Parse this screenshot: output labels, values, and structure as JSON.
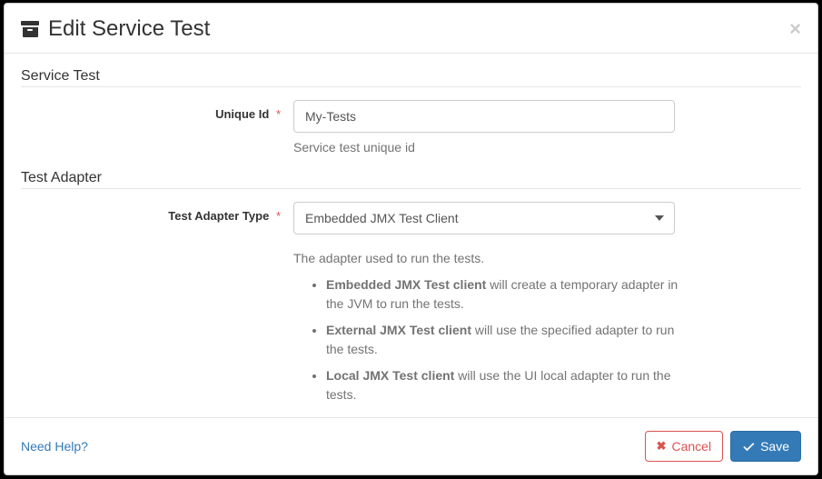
{
  "modal": {
    "title": "Edit Service Test",
    "close_label": "×"
  },
  "sections": {
    "service_test": {
      "legend": "Service Test",
      "unique_id": {
        "label": "Unique Id",
        "value": "My-Tests",
        "help": "Service test unique id"
      }
    },
    "test_adapter": {
      "legend": "Test Adapter",
      "type": {
        "label": "Test Adapter Type",
        "selected": "Embedded JMX Test Client",
        "help_intro": "The adapter used to run the tests.",
        "bullets": [
          {
            "strong": "Embedded JMX Test client",
            "rest": " will create a temporary adapter in the JVM to run the tests."
          },
          {
            "strong": "External JMX Test client",
            "rest": " will use the specified adapter to run the tests."
          },
          {
            "strong": "Local JMX Test client",
            "rest": " will use the UI local adapter to run the tests."
          }
        ]
      }
    }
  },
  "footer": {
    "help_link": "Need Help?",
    "cancel": "Cancel",
    "save": "Save"
  }
}
